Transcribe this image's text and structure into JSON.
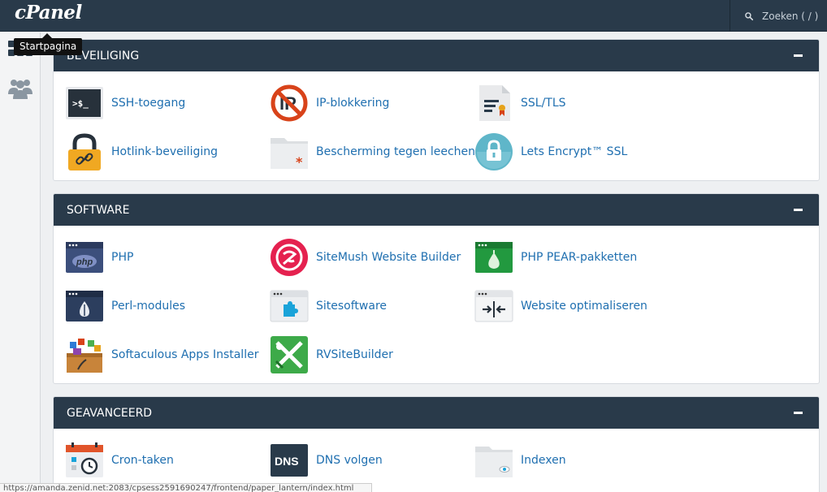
{
  "header": {
    "logo_text": "cPanel",
    "search_placeholder": "Zoeken ( / )"
  },
  "sidebar": {
    "items": [
      {
        "icon": "grid-icon",
        "label": "Startpagina"
      },
      {
        "icon": "users-icon",
        "label": ""
      }
    ],
    "tooltip": "Startpagina"
  },
  "colors": {
    "topbar": "#293a4a",
    "link": "#1f6fb0",
    "background": "#eef0f2"
  },
  "sections": [
    {
      "title": "BEVEILIGING",
      "items": [
        {
          "label": "SSH-toegang",
          "icon": "terminal-icon"
        },
        {
          "label": "IP-blokkering",
          "icon": "ip-block-icon"
        },
        {
          "label": "SSL/TLS",
          "icon": "certificate-icon"
        },
        {
          "label": "Hotlink-beveiliging",
          "icon": "padlock-link-icon"
        },
        {
          "label": "Bescherming tegen leechen",
          "icon": "protected-folder-icon"
        },
        {
          "label": "Lets Encrypt™ SSL",
          "icon": "lets-encrypt-icon"
        }
      ]
    },
    {
      "title": "SOFTWARE",
      "items": [
        {
          "label": "PHP",
          "icon": "php-icon"
        },
        {
          "label": "SiteMush Website Builder",
          "icon": "sitemush-icon"
        },
        {
          "label": "PHP PEAR-pakketten",
          "icon": "php-pear-icon"
        },
        {
          "label": "Perl-modules",
          "icon": "perl-icon"
        },
        {
          "label": "Sitesoftware",
          "icon": "puzzle-icon"
        },
        {
          "label": "Website optimaliseren",
          "icon": "optimize-icon"
        },
        {
          "label": "Softaculous Apps Installer",
          "icon": "softaculous-icon"
        },
        {
          "label": "RVSiteBuilder",
          "icon": "rvsitebuilder-icon"
        }
      ]
    },
    {
      "title": "GEAVANCEERD",
      "items": [
        {
          "label": "Cron-taken",
          "icon": "calendar-clock-icon"
        },
        {
          "label": "DNS volgen",
          "icon": "dns-icon"
        },
        {
          "label": "Indexen",
          "icon": "folder-eye-icon"
        }
      ]
    }
  ],
  "status_bar": {
    "url": "https://amanda.zenid.net:2083/cpsess2591690247/frontend/paper_lantern/index.html"
  }
}
